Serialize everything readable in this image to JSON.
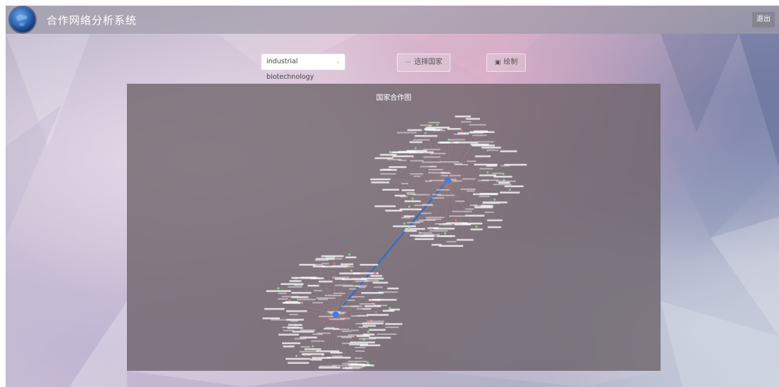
{
  "header": {
    "title": "合作网络分析系统",
    "logout_label": "退出",
    "logo_icon": "globe-icon"
  },
  "controls": {
    "field_select": {
      "value": "industrial biotechnology",
      "icon": "chevron-down-icon"
    },
    "select_country_button": {
      "label": "选择国家",
      "icon": "more-icon"
    },
    "draw_button": {
      "label": "绘制",
      "icon": "image-icon"
    }
  },
  "chart": {
    "title": "国家合作图",
    "colors": {
      "hub": "#3d7fe0",
      "edge_main": "#2f6fc7",
      "node_green": "#7ed47a",
      "node_red": "#e8726a",
      "edge_spoke": "#c08a80",
      "label": "#ffffff"
    }
  },
  "chart_data": {
    "type": "network",
    "title": "国家合作图",
    "clusters": 2,
    "hub_links": 1
  }
}
